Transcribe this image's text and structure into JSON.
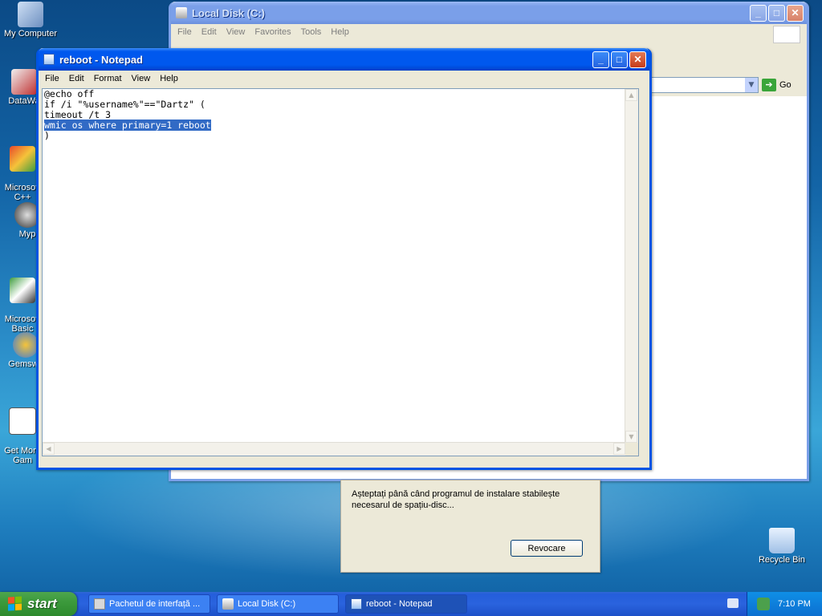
{
  "desktop": {
    "icons": [
      {
        "label": "My Computer",
        "icon": "my-computer-icon"
      },
      {
        "label": "DataWa",
        "icon": "datawa-icon"
      },
      {
        "label": "Microsoft\nC++",
        "icon": "visual-cpp-icon"
      },
      {
        "label": "Myp",
        "icon": "myp-icon"
      },
      {
        "label": "Microsoft\nBasic",
        "icon": "visual-basic-icon"
      },
      {
        "label": "Gemswe",
        "icon": "gemswe-icon"
      },
      {
        "label": "Get More\nGam",
        "icon": "get-more-games-icon"
      },
      {
        "label": "Recycle Bin",
        "icon": "recycle-bin-icon"
      }
    ]
  },
  "explorer": {
    "title": "Local Disk (C:)",
    "menu": [
      "File",
      "Edit",
      "View",
      "Favorites",
      "Tools",
      "Help"
    ],
    "go_label": "Go"
  },
  "notepad": {
    "title": "reboot - Notepad",
    "menu": [
      "File",
      "Edit",
      "Format",
      "View",
      "Help"
    ],
    "lines": [
      "@echo off",
      "if /i \"%username%\"==\"Dartz\" (",
      "timeout /t 3",
      "wmic os where primary=1 reboot",
      ")"
    ],
    "selected_line": "wmic os where primary=1 reboot"
  },
  "installer": {
    "message_line1": "Așteptați până când programul de instalare stabilește",
    "message_line2": "necesarul de spațiu-disc...",
    "cancel_label": "Revocare"
  },
  "taskbar": {
    "start_label": "start",
    "tasks": [
      {
        "label": "Pachetul de interfață ...",
        "active": false
      },
      {
        "label": "Local Disk (C:)",
        "active": false
      },
      {
        "label": "reboot - Notepad",
        "active": true
      }
    ],
    "clock": "7:10 PM"
  },
  "colors": {
    "titlebar_active": "#0058ee",
    "selection": "#316ac5",
    "start_green": "#3c9a3c",
    "taskbar_blue": "#245edb"
  }
}
